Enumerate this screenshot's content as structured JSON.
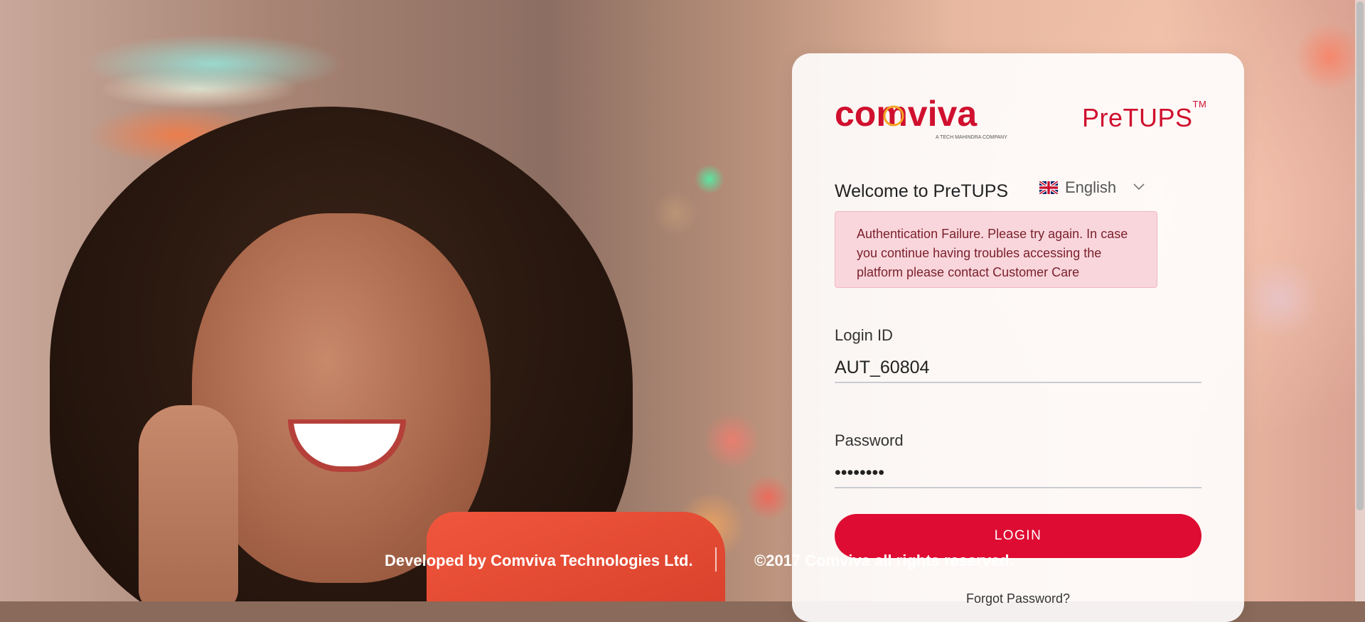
{
  "brand": {
    "company_logo_text": "comviva",
    "company_tagline": "A TECH MAHINDRA COMPANY",
    "product_name": "PreTUPS",
    "product_trademark": "TM",
    "brand_color": "#de0b32"
  },
  "login_panel": {
    "welcome_text": "Welcome to PreTUPS",
    "language": {
      "selected": "English",
      "flag_icon": "uk-flag-icon",
      "chevron_icon": "chevron-down-icon"
    },
    "alert": {
      "message": "Authentication Failure. Please try again. In case you continue having troubles accessing the platform please contact Customer Care"
    },
    "login_id": {
      "label": "Login ID",
      "value": "AUT_60804"
    },
    "password": {
      "label": "Password",
      "value": "••••••••"
    },
    "login_button_label": "LOGIN",
    "forgot_password_link": "Forgot Password?"
  },
  "footer": {
    "developed_by": "Developed by Comviva Technologies Ltd.",
    "copyright": "©2017 Comviva all rights reserved."
  }
}
